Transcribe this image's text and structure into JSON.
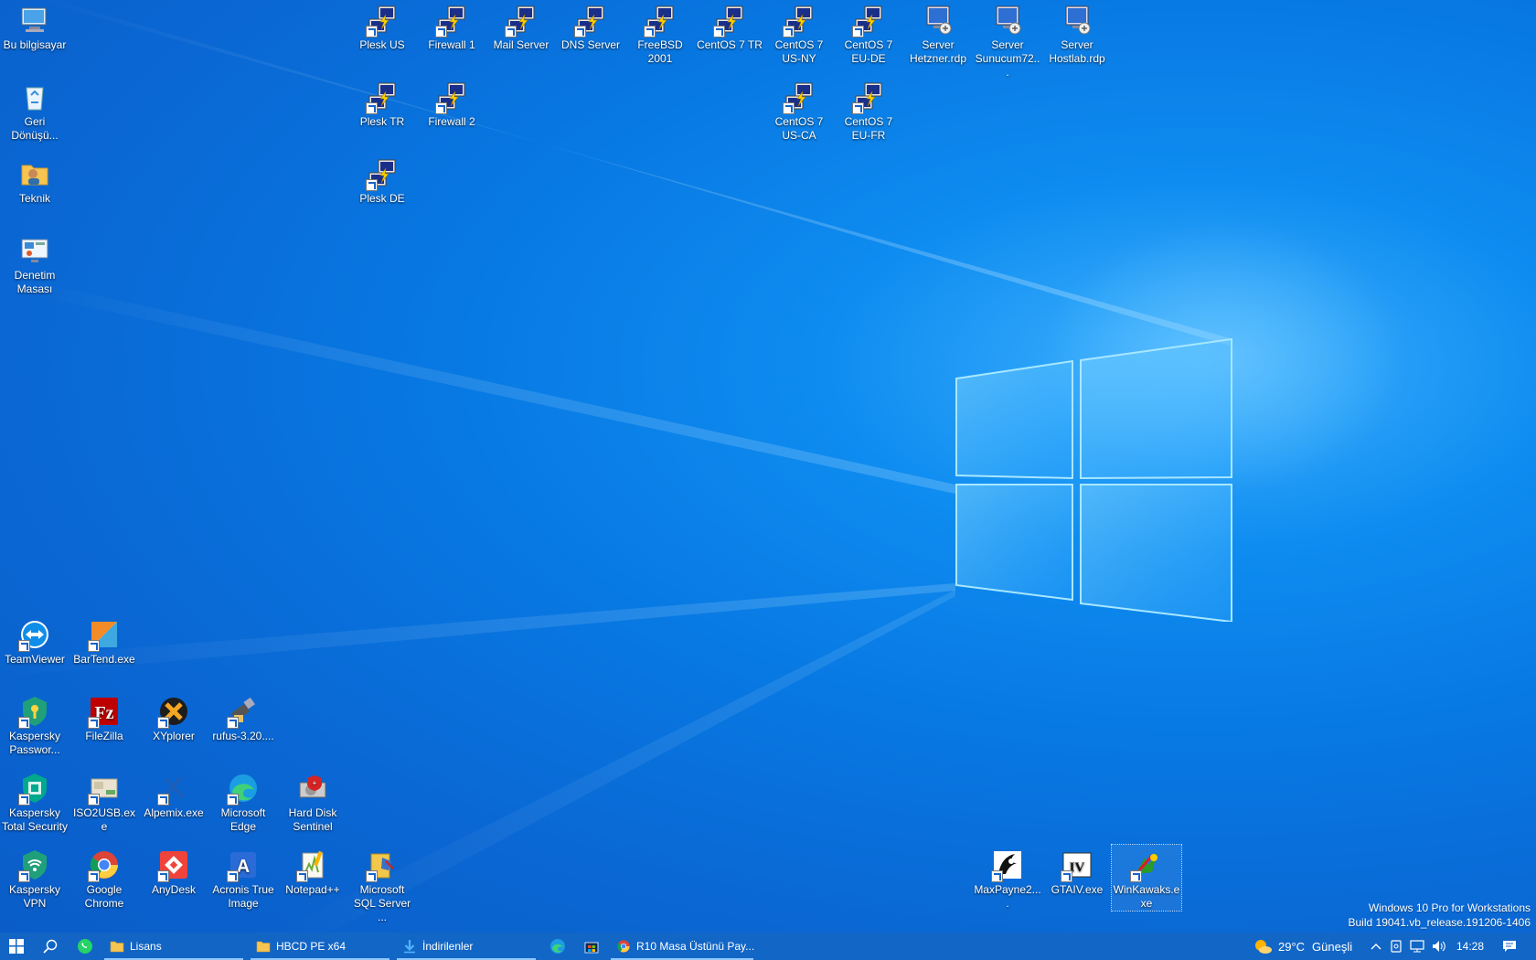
{
  "desktop_icons": [
    {
      "label": "Bu bilgisayar",
      "icon": "computer-icon"
    },
    {
      "label": "Geri Dönüşü...",
      "icon": "recycle-bin-icon"
    },
    {
      "label": "Teknik",
      "icon": "user-folder-icon"
    },
    {
      "label": "Denetim Masası",
      "icon": "control-panel-icon"
    },
    {
      "label": "Plesk US",
      "icon": "putty-icon"
    },
    {
      "label": "Plesk TR",
      "icon": "putty-icon"
    },
    {
      "label": "Plesk DE",
      "icon": "putty-icon"
    },
    {
      "label": "Firewall 1",
      "icon": "putty-icon"
    },
    {
      "label": "Firewall 2",
      "icon": "putty-icon"
    },
    {
      "label": "Mail Server",
      "icon": "putty-icon"
    },
    {
      "label": "DNS Server",
      "icon": "putty-icon"
    },
    {
      "label": "FreeBSD 2001",
      "icon": "putty-icon"
    },
    {
      "label": "CentOS 7 TR",
      "icon": "putty-icon"
    },
    {
      "label": "CentOS 7 US-NY",
      "icon": "putty-icon"
    },
    {
      "label": "CentOS 7 US-CA",
      "icon": "putty-icon"
    },
    {
      "label": "CentOS 7 EU-DE",
      "icon": "putty-icon"
    },
    {
      "label": "CentOS 7 EU-FR",
      "icon": "putty-icon"
    },
    {
      "label": "Server Hetzner.rdp",
      "icon": "remote-desktop-icon"
    },
    {
      "label": "Server Sunucum72...",
      "icon": "remote-desktop-icon"
    },
    {
      "label": "Server Hostlab.rdp",
      "icon": "remote-desktop-icon"
    },
    {
      "label": "TeamViewer",
      "icon": "teamviewer-icon"
    },
    {
      "label": "BarTend.exe",
      "icon": "bartend-icon"
    },
    {
      "label": "Kaspersky Passwor...",
      "icon": "kaspersky-password-icon"
    },
    {
      "label": "FileZilla",
      "icon": "filezilla-icon"
    },
    {
      "label": "XYplorer",
      "icon": "xyplorer-icon"
    },
    {
      "label": "rufus-3.20....",
      "icon": "rufus-icon"
    },
    {
      "label": "Kaspersky Total Security",
      "icon": "kaspersky-total-icon"
    },
    {
      "label": "ISO2USB.exe",
      "icon": "iso2usb-icon"
    },
    {
      "label": "Alpemix.exe",
      "icon": "alpemix-icon"
    },
    {
      "label": "Microsoft Edge",
      "icon": "edge-icon"
    },
    {
      "label": "Hard Disk Sentinel",
      "icon": "hard-disk-sentinel-icon"
    },
    {
      "label": "Kaspersky VPN",
      "icon": "kaspersky-vpn-icon"
    },
    {
      "label": "Google Chrome",
      "icon": "chrome-icon"
    },
    {
      "label": "AnyDesk",
      "icon": "anydesk-icon"
    },
    {
      "label": "Acronis True Image",
      "icon": "acronis-icon"
    },
    {
      "label": "Notepad++",
      "icon": "notepadpp-icon"
    },
    {
      "label": "Microsoft SQL Server ...",
      "icon": "sql-server-icon"
    },
    {
      "label": "MaxPayne2....",
      "icon": "maxpayne-icon"
    },
    {
      "label": "GTAIV.exe",
      "icon": "gtaiv-icon"
    },
    {
      "label": "WinKawaks.exe",
      "icon": "winkawaks-icon"
    }
  ],
  "watermark": {
    "line1": "Windows 10 Pro for Workstations",
    "line2": "Build 19041.vb_release.191206-1406"
  },
  "taskbar": {
    "apps": [
      {
        "title": "Lisans",
        "icon": "folder-icon"
      },
      {
        "title": "HBCD PE x64",
        "icon": "folder-icon"
      },
      {
        "title": "İndirilenler",
        "icon": "downloads-icon"
      },
      {
        "title": "R10 Masa Üstünü Pay...",
        "icon": "chrome-icon"
      }
    ],
    "weather_temp": "29°C",
    "weather_text": "Güneşli",
    "clock": "14:28"
  },
  "colors": {
    "accent": "#0a78e2",
    "taskbar": "#1466c4"
  }
}
